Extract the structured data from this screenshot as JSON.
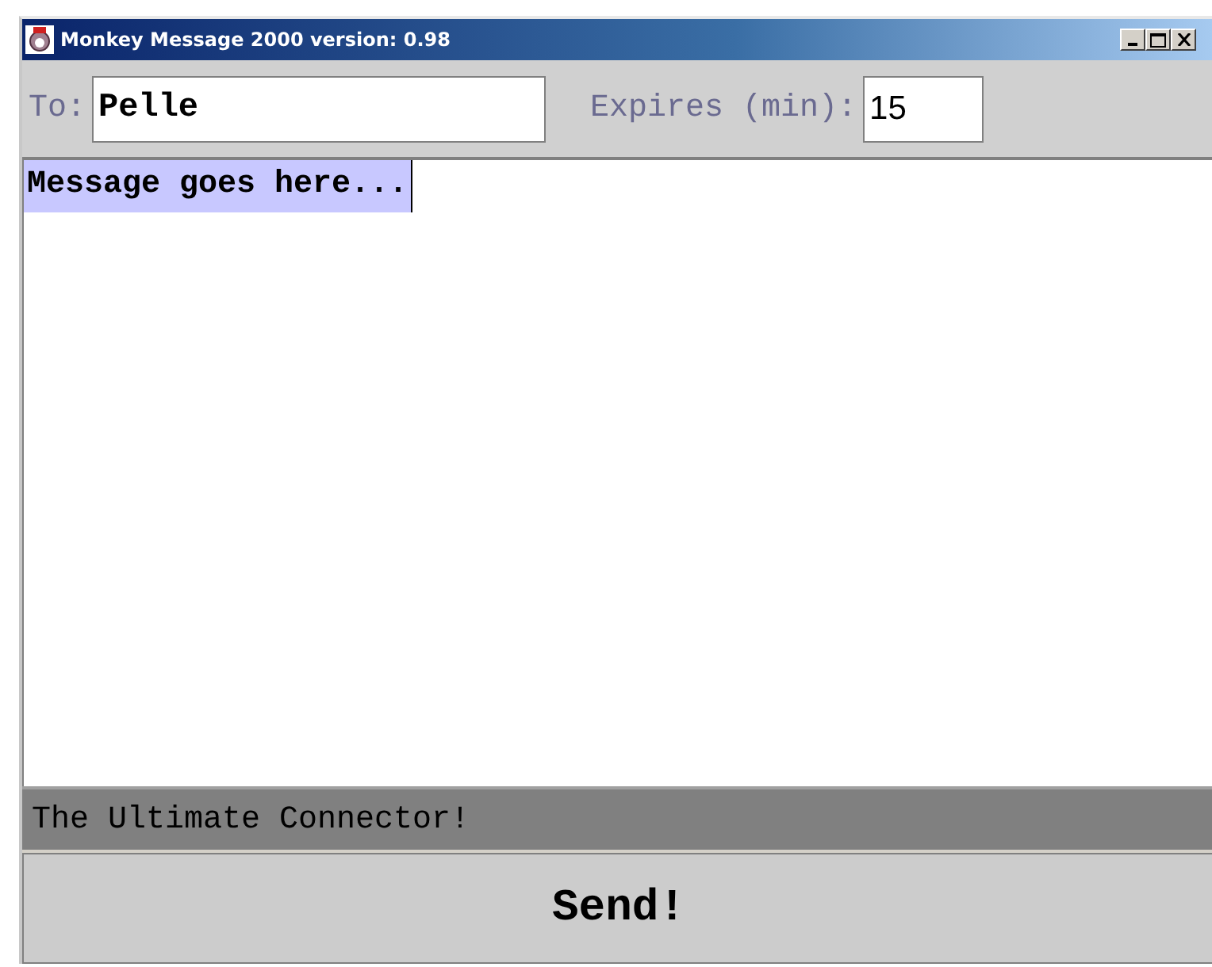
{
  "window": {
    "title": "Monkey Message 2000 version: 0.98"
  },
  "to": {
    "label": "To:",
    "value": "Pelle"
  },
  "expires": {
    "label": "Expires (min):",
    "value": "15"
  },
  "message": {
    "text": "Message goes here...",
    "selected": true
  },
  "status_bar": "The Ultimate Connector!",
  "send_button": "Send!"
}
